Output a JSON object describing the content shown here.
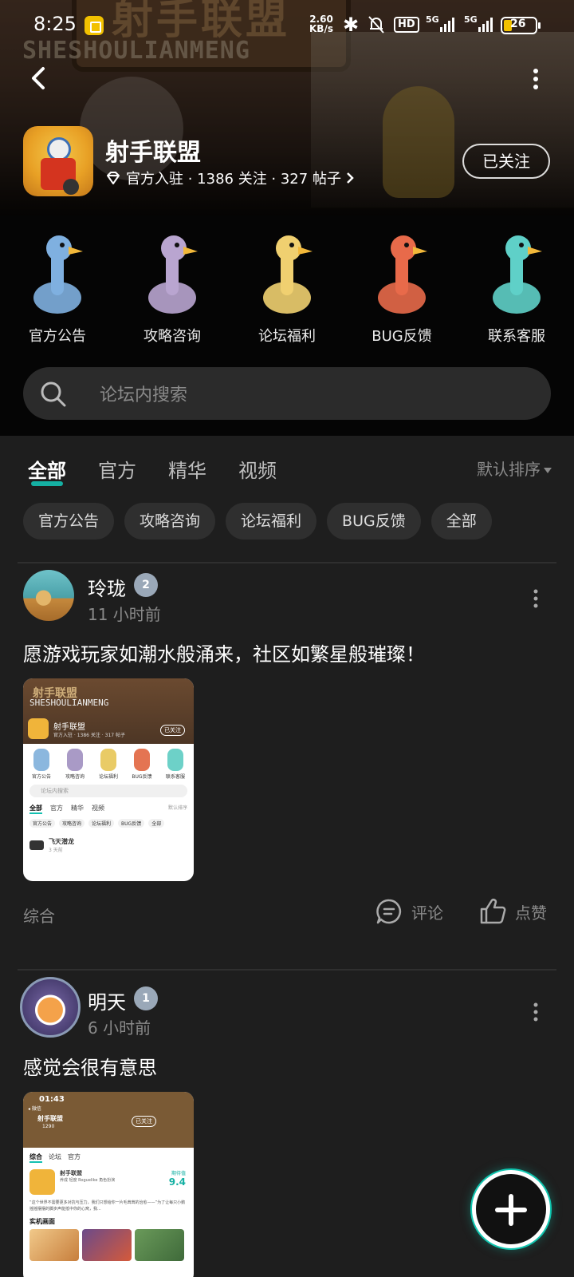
{
  "status_bar": {
    "time": "8:25",
    "net_speed": "2.60",
    "net_unit": "KB/s",
    "hd": "HD",
    "sig1": "5G",
    "sig2": "5G",
    "battery": "26"
  },
  "header": {
    "banner_cn": "射手联盟",
    "banner_en": "SHESHOULIANMENG",
    "forum_name": "射手联盟",
    "meta": "官方入驻 · 1386 关注 · 327 帖子",
    "follow_label": "已关注"
  },
  "shortcuts": [
    {
      "label": "官方公告",
      "icon": "cockatoo-icon",
      "color": "#7fb0e0"
    },
    {
      "label": "攻略咨询",
      "icon": "robot-bird-icon",
      "color": "#b9a5d0"
    },
    {
      "label": "论坛福利",
      "icon": "goose-glasses-icon",
      "color": "#f0d070"
    },
    {
      "label": "BUG反馈",
      "icon": "goose-bandana-icon",
      "color": "#e86a4a"
    },
    {
      "label": "联系客服",
      "icon": "skeleton-bird-icon",
      "color": "#5fd0c8"
    }
  ],
  "search": {
    "placeholder": "论坛内搜索"
  },
  "tabs": [
    "全部",
    "官方",
    "精华",
    "视频"
  ],
  "sort_label": "默认排序",
  "chips": [
    "官方公告",
    "攻略咨询",
    "论坛福利",
    "BUG反馈",
    "全部"
  ],
  "posts": [
    {
      "author": "玲珑",
      "level": "2",
      "time": "11 小时前",
      "text": "愿游戏玩家如潮水般涌来，社区如繁星般璀璨！",
      "tag": "综合",
      "comment_label": "评论",
      "like_label": "点赞",
      "thumb": {
        "sign": "射手联盟",
        "en": "SHESHOULIANMENG",
        "name": "射手联盟",
        "sub": "官方入驻 · 1386 关注 · 317 帖子",
        "follow": "已关注",
        "figs": [
          "官方公告",
          "攻略咨询",
          "论坛福利",
          "BUG反馈",
          "联系客服"
        ],
        "search": "论坛内搜索",
        "tabs": [
          "全部",
          "官方",
          "精华",
          "视频"
        ],
        "sort": "默认排序",
        "chips": [
          "官方公告",
          "攻略咨询",
          "论坛福利",
          "BUG反馈",
          "全部"
        ],
        "user": "飞天潜龙",
        "user_time": "3 天前"
      }
    },
    {
      "author": "明天",
      "level": "1",
      "time": "6 小时前",
      "text": "感觉会很有意思",
      "thumb": {
        "time": "01:43",
        "wx": "◂ 微信",
        "title": "射手联盟",
        "count": "1290",
        "follow": "已关注",
        "tabs": [
          "综合",
          "论坛",
          "官方"
        ],
        "app_name": "射手联盟",
        "app_tags": "养成  轻度 Roguelike  角色扮演",
        "score_label": "期待值",
        "score": "9.4",
        "quote": "“这个世界不需要更多对抗与压力，我们只想给你一片毛茸茸的治愈——”为了让每只小鹅摇摇摆摆的脚步声能抵中你的心窝，我...",
        "section": "实机画面"
      }
    }
  ],
  "colors": {
    "accent": "#14c0b1",
    "background": "#1e1e1e",
    "chip": "#2f2f2f"
  }
}
